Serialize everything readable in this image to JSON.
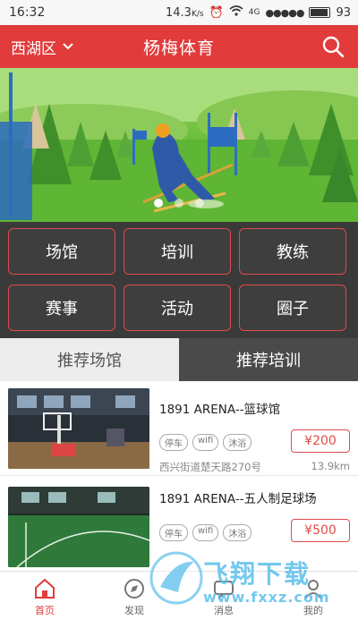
{
  "status_bar": {
    "time": "16:32",
    "data_speed": "14.3",
    "data_unit": "K/s",
    "network": "4G",
    "battery": "93"
  },
  "header": {
    "city": "西湖区",
    "title": "杨梅体育"
  },
  "banner": {
    "slide_count": 3,
    "active_slide": 0
  },
  "categories": [
    "场馆",
    "培训",
    "教练",
    "赛事",
    "活动",
    "圈子"
  ],
  "tabs": [
    {
      "label": "推荐场馆",
      "active": false
    },
    {
      "label": "推荐培训",
      "active": true
    }
  ],
  "venues": [
    {
      "name": "1891 ARENA--篮球馆",
      "tags": [
        "停车",
        "wifi",
        "沐浴"
      ],
      "price": "¥200",
      "address": "西兴街道楚天路270号",
      "distance": "13.9km"
    },
    {
      "name": "1891 ARENA--五人制足球场",
      "tags": [
        "停车",
        "wifi",
        "沐浴"
      ],
      "price": "¥500",
      "address": "",
      "distance": ""
    }
  ],
  "bottom_nav": [
    {
      "label": "首页",
      "icon": "home-icon",
      "active": true
    },
    {
      "label": "发现",
      "icon": "compass-icon",
      "active": false
    },
    {
      "label": "消息",
      "icon": "message-icon",
      "active": false
    },
    {
      "label": "我的",
      "icon": "user-icon",
      "active": false
    }
  ],
  "watermark": {
    "brand": "飞翔下载",
    "url": "www.fxxz.com"
  },
  "colors": {
    "primary": "#e23b3b",
    "dark": "#3a3a3a"
  }
}
